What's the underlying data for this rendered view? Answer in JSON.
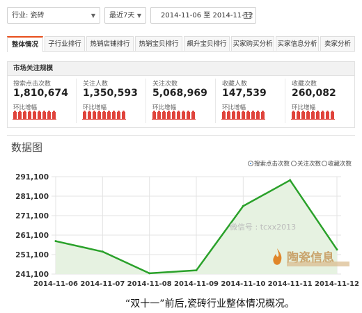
{
  "filters": {
    "industry": "行业: 瓷砖",
    "period": "最近7天",
    "date_range": "2014-11-06 至 2014-11-12"
  },
  "tabs": [
    "整体情况",
    "子行业排行",
    "热销店铺排行",
    "热销宝贝排行",
    "飙升宝贝排行",
    "买家购买分析",
    "买家信息分析",
    "卖家分析"
  ],
  "active_tab": 0,
  "market": {
    "title": "市场关注规模",
    "trend_label": "环比增幅",
    "metrics": [
      {
        "label": "搜索点击次数",
        "value": "1,810,674"
      },
      {
        "label": "关注人数",
        "value": "1,350,593"
      },
      {
        "label": "关注次数",
        "value": "5,068,969"
      },
      {
        "label": "收藏人数",
        "value": "147,539"
      },
      {
        "label": "收藏次数",
        "value": "260,082"
      }
    ]
  },
  "chart_section": {
    "title": "数据图",
    "legend": [
      "搜索点击次数",
      "关注次数",
      "收藏次数"
    ],
    "selected_legend": 0
  },
  "chart_data": {
    "type": "area",
    "title": "",
    "xlabel": "",
    "ylabel": "",
    "categories": [
      "2014-11-06",
      "2014-11-07",
      "2014-11-08",
      "2014-11-09",
      "2014-11-10",
      "2014-11-11",
      "2014-11-12"
    ],
    "series": [
      {
        "name": "搜索点击次数",
        "values": [
          258000,
          252600,
          241500,
          243000,
          276000,
          289300,
          253700
        ]
      }
    ],
    "yticks": [
      "241,100",
      "251,100",
      "261,100",
      "271,100",
      "281,100",
      "291,100"
    ],
    "ylim": [
      241100,
      291100
    ],
    "grid": true,
    "colors": {
      "line": "#2aa12a",
      "fill": "#e6f2e1",
      "grid": "#e3e3e3"
    }
  },
  "watermark": "微信号 : tcxx2013",
  "logo": {
    "name": "陶瓷信息"
  },
  "caption": "“双十一”前后,瓷砖行业整体情况概况。"
}
